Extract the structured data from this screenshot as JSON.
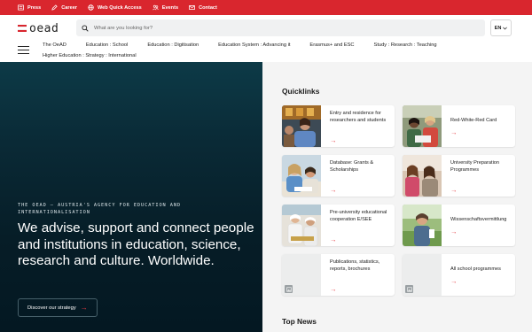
{
  "topbar": {
    "items": [
      {
        "label": "Press",
        "icon": "newspaper-icon"
      },
      {
        "label": "Career",
        "icon": "pen-icon"
      },
      {
        "label": "Web Quick Access",
        "icon": "globe-icon"
      },
      {
        "label": "Events",
        "icon": "people-icon"
      },
      {
        "label": "Contact",
        "icon": "envelope-icon"
      }
    ],
    "color": "#d9262e"
  },
  "header": {
    "logo_text": "oead",
    "search_placeholder": "What are you looking for?",
    "language": "EN",
    "nav": {
      "row1": [
        "The OeAD",
        "Education : School",
        "Education : Digitisation",
        "Education System : Advancing it",
        "Erasmus+ and ESC",
        "Study : Research : Teaching"
      ],
      "row2": [
        "Higher Education : Strategy : International"
      ]
    }
  },
  "hero": {
    "kicker": "The OeAD – Austria's agency for education and internationalisation",
    "headline": "We advise, support and connect people and institutions in education, science, research and culture. Worldwide.",
    "cta_label": "Discover our strategy",
    "arrow": "→"
  },
  "quicklinks": {
    "title": "Quicklinks",
    "items": [
      {
        "label": "Entry and residence for researchers and students",
        "image": "photo"
      },
      {
        "label": "Red-White-Red Card",
        "image": "photo"
      },
      {
        "label": "Database: Grants & Scholarships",
        "image": "photo"
      },
      {
        "label": "University Preparation Programmes",
        "image": "photo"
      },
      {
        "label": "Pre-university educational cooperation E/SEE",
        "image": "photo"
      },
      {
        "label": "Wissenschaftsvermittlung",
        "image": "photo"
      },
      {
        "label": "Publications, statistics, reports, brochures",
        "image": "placeholder"
      },
      {
        "label": "All school programmes",
        "image": "placeholder"
      }
    ],
    "arrow": "→"
  },
  "top_news": {
    "title": "Top News"
  },
  "colors": {
    "accent": "#e43a40",
    "hero_bg": "#0a2a36",
    "content_bg": "#f4f4f4"
  }
}
